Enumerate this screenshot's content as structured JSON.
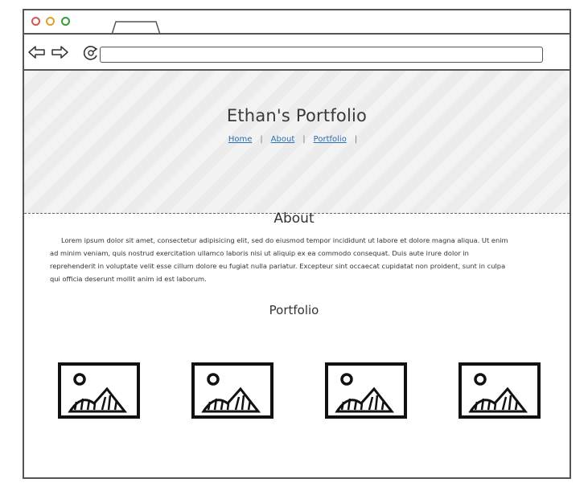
{
  "browser": {
    "url": ""
  },
  "hero": {
    "title": "Ethan's Portfolio",
    "nav": [
      {
        "label": "Home"
      },
      {
        "label": "About"
      },
      {
        "label": "Portfolio"
      }
    ],
    "separator": "|"
  },
  "about": {
    "title": "About",
    "text": "Lorem ipsum dolor sit amet, consectetur adipisicing elit, sed do eiusmod tempor incididunt ut labore et dolore magna aliqua. Ut enim ad minim veniam, quis nostrud exercitation ullamco laboris nisi ut aliquip ex ea commodo consequat. Duis aute irure dolor in reprehenderit in voluptate velit esse cillum dolore eu fugiat nulla pariatur. Excepteur sint occaecat cupidatat non proident, sunt in culpa qui officia deserunt mollit anim id est laborum."
  },
  "portfolio": {
    "title": "Portfolio",
    "items": [
      {
        "icon": "image-placeholder-icon"
      },
      {
        "icon": "image-placeholder-icon"
      },
      {
        "icon": "image-placeholder-icon"
      },
      {
        "icon": "image-placeholder-icon"
      }
    ]
  },
  "colors": {
    "link": "#2a6fb0",
    "close": "#d9534f",
    "minimize": "#e0a030",
    "maximize": "#3a9a3a"
  }
}
